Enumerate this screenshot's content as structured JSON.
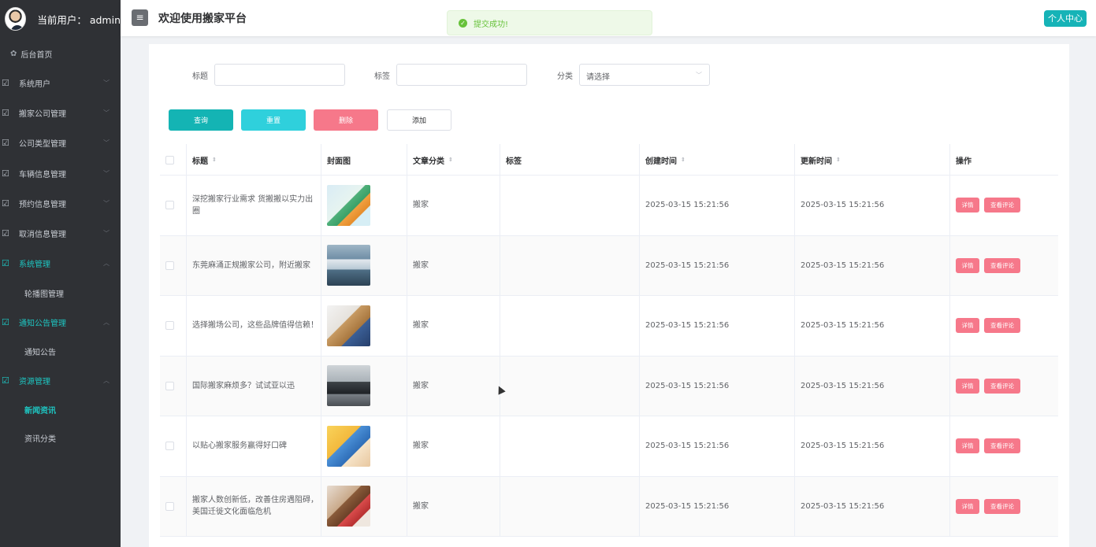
{
  "sidebar": {
    "user_label": "当前用户： admin",
    "home_label": "后台首页",
    "menu": [
      {
        "label": "系统用户",
        "active": false
      },
      {
        "label": "搬家公司管理",
        "active": false
      },
      {
        "label": "公司类型管理",
        "active": false
      },
      {
        "label": "车辆信息管理",
        "active": false
      },
      {
        "label": "预约信息管理",
        "active": false
      },
      {
        "label": "取消信息管理",
        "active": false
      },
      {
        "label": "系统管理",
        "active": true,
        "children": [
          "轮播图管理"
        ]
      },
      {
        "label": "通知公告管理",
        "active": true,
        "children": [
          "通知公告"
        ]
      },
      {
        "label": "资源管理",
        "active": true,
        "children": [
          "新闻资讯",
          "资讯分类"
        ],
        "current_child": "新闻资讯"
      }
    ]
  },
  "header": {
    "title": "欢迎使用搬家平台",
    "profile_button": "个人中心"
  },
  "toast": {
    "message": "提交成功!",
    "color": "#67c23a"
  },
  "search": {
    "title_label": "标题",
    "tags_label": "标签",
    "category_label": "分类",
    "category_placeholder": "请选择"
  },
  "actions": {
    "query": "查询",
    "reset": "重置",
    "delete": "删除",
    "add": "添加"
  },
  "table": {
    "columns": [
      "标题",
      "封面图",
      "文章分类",
      "标签",
      "创建时间",
      "更新时间",
      "操作"
    ],
    "row_actions": {
      "detail": "详情",
      "comments": "查看评论"
    },
    "rows": [
      {
        "title": "深挖搬家行业需求 货搬搬以实力出圈",
        "category": "搬家",
        "tags": "",
        "created": "2025-03-15 15:21:56",
        "updated": "2025-03-15 15:21:56"
      },
      {
        "title": "东莞麻涌正规搬家公司，附近搬家",
        "category": "搬家",
        "tags": "",
        "created": "2025-03-15 15:21:56",
        "updated": "2025-03-15 15:21:56"
      },
      {
        "title": "选择搬场公司，这些品牌值得信赖！",
        "category": "搬家",
        "tags": "",
        "created": "2025-03-15 15:21:56",
        "updated": "2025-03-15 15:21:56"
      },
      {
        "title": "国际搬家麻烦多？试试亚以迅",
        "category": "搬家",
        "tags": "",
        "created": "2025-03-15 15:21:56",
        "updated": "2025-03-15 15:21:56"
      },
      {
        "title": "以贴心搬家服务赢得好口碑",
        "category": "搬家",
        "tags": "",
        "created": "2025-03-15 15:21:56",
        "updated": "2025-03-15 15:21:56"
      },
      {
        "title": "搬家人数创新低，改善住房遇阻碍，美国迁徙文化面临危机",
        "category": "搬家",
        "tags": "",
        "created": "2025-03-15 15:21:56",
        "updated": "2025-03-15 15:21:56"
      }
    ]
  },
  "theme": {
    "accent": "#14b4b4",
    "danger": "#f6788a",
    "sidebar_bg": "#2f3135"
  }
}
